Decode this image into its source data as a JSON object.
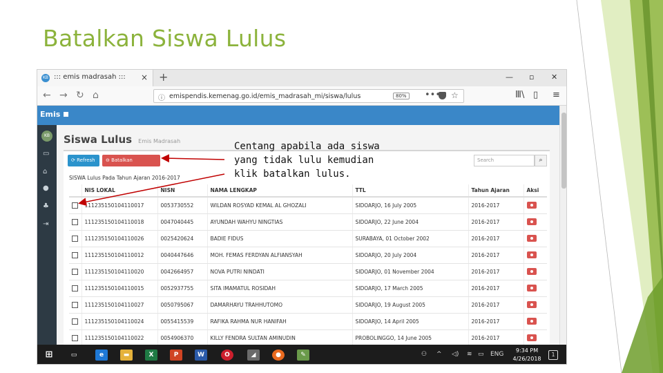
{
  "slide": {
    "title": "Batalkan Siswa Lulus",
    "callout": "Centang apabila ada siswa yang tidak lulu kemudian klik batalkan lulus."
  },
  "browser": {
    "tab_title": "::: emis madrasah :::",
    "tab_close": "×",
    "new_tab": "+",
    "url": "emispendis.kemenag.go.id/emis_madrasah_mi/siswa/lulus",
    "url_badge": "80%",
    "url_more": "•••",
    "win_min": "—",
    "win_max": "▫",
    "win_close": "✕"
  },
  "app": {
    "logo": "Emis",
    "avatar": "KB",
    "page_title": "Siswa Lulus",
    "page_subtitle": "Emis Madrasah",
    "buttons": {
      "refresh": "Refresh",
      "batal": "Batalkan Kelulusan"
    },
    "search_placeholder": "Search",
    "table_caption": "SISWA Lulus Pada Tahun Ajaran 2016-2017",
    "columns": [
      "NIS LOKAL",
      "NISN",
      "NAMA LENGKAP",
      "TTL",
      "Tahun Ajaran",
      "Aksi"
    ],
    "rows": [
      {
        "nis": "111235150104110017",
        "nisn": "0053730552",
        "nama": "WILDAN ROSYAD KEMAL AL GHOZALI",
        "ttl": "SIDOARJO, 16 July 2005",
        "tahun": "2016-2017"
      },
      {
        "nis": "111235150104110018",
        "nisn": "0047040445",
        "nama": "AYUNDAH WAHYU NINGTIAS",
        "ttl": "SIDOARJO, 22 June 2004",
        "tahun": "2016-2017"
      },
      {
        "nis": "111235150104110026",
        "nisn": "0025420624",
        "nama": "BADIE FIDUS",
        "ttl": "SURABAYA, 01 October 2002",
        "tahun": "2016-2017"
      },
      {
        "nis": "111235150104110012",
        "nisn": "0040447646",
        "nama": "MOH. FEMAS FERDYAN ALFIANSYAH",
        "ttl": "SIDOARJO, 20 July 2004",
        "tahun": "2016-2017"
      },
      {
        "nis": "111235150104110020",
        "nisn": "0042664957",
        "nama": "NOVA PUTRI NINDATI",
        "ttl": "SIDOARJO, 01 November 2004",
        "tahun": "2016-2017"
      },
      {
        "nis": "111235150104110015",
        "nisn": "0052937755",
        "nama": "SITA IMAMATUL ROSIDAH",
        "ttl": "SIDOARJO, 17 March 2005",
        "tahun": "2016-2017"
      },
      {
        "nis": "111235150104110027",
        "nisn": "0050795067",
        "nama": "DAMARHAYU TRAHHUTOMO",
        "ttl": "SIDOARJO, 19 August 2005",
        "tahun": "2016-2017"
      },
      {
        "nis": "111235150104110024",
        "nisn": "0055415539",
        "nama": "RAFIKA RAHMA NUR HANIFAH",
        "ttl": "SIDOARJO, 14 April 2005",
        "tahun": "2016-2017"
      },
      {
        "nis": "111235150104110022",
        "nisn": "0054906370",
        "nama": "KILLY FENDRA SULTAN AMINUDIN",
        "ttl": "PROBOLINGGO, 14 June 2005",
        "tahun": "2016-2017"
      }
    ]
  },
  "taskbar": {
    "lang": "ENG",
    "time": "9:34 PM",
    "date": "4/26/2018",
    "notif": "1"
  },
  "colors": {
    "title": "#8cb33c",
    "header": "#3a87c8",
    "sidebar": "#2d3a44",
    "danger": "#d9534f",
    "primary": "#2b93cc"
  }
}
